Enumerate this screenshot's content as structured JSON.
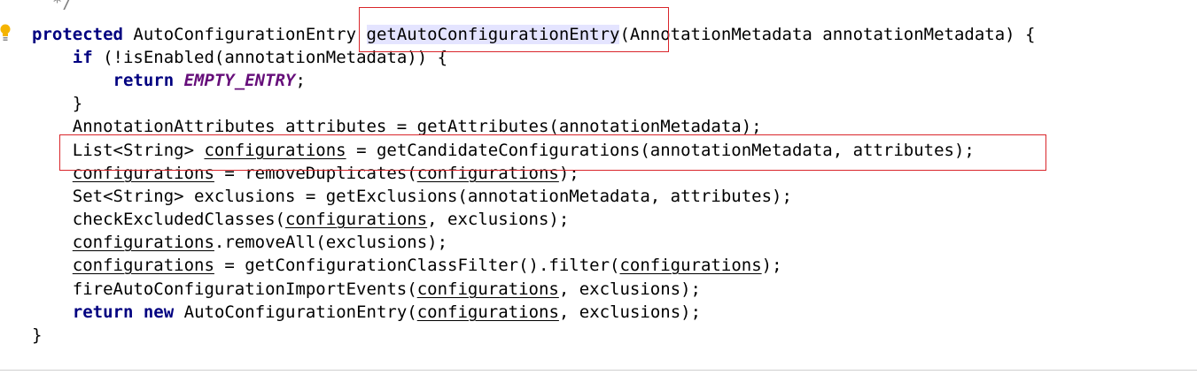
{
  "editor": {
    "lines": [
      {
        "tokens": [
          {
            "t": "  */",
            "c": "comment"
          }
        ]
      },
      {
        "tokens": [
          {
            "t": "protected",
            "c": "kw"
          },
          {
            "t": " AutoConfigurationEntry "
          },
          {
            "t": "",
            "c": "caret"
          },
          {
            "t": "getAutoConfigurationEntry",
            "c": "hl"
          },
          {
            "t": "(AnnotationMetadata annotationMetadata) {"
          }
        ]
      },
      {
        "tokens": [
          {
            "t": "    "
          },
          {
            "t": "if",
            "c": "kw"
          },
          {
            "t": " (!isEnabled(annotationMetadata)) {"
          }
        ]
      },
      {
        "tokens": [
          {
            "t": "        "
          },
          {
            "t": "return",
            "c": "kw"
          },
          {
            "t": " "
          },
          {
            "t": "EMPTY_ENTRY",
            "c": "const"
          },
          {
            "t": ";"
          }
        ]
      },
      {
        "tokens": [
          {
            "t": "    }"
          }
        ]
      },
      {
        "tokens": [
          {
            "t": "    AnnotationAttributes attributes = getAttributes(annotationMetadata);"
          }
        ]
      },
      {
        "tokens": [
          {
            "t": "    List<String> "
          },
          {
            "t": "configurations",
            "c": "var"
          },
          {
            "t": " = getCandidateConfigurations(annotationMetadata, attributes);"
          }
        ]
      },
      {
        "tokens": [
          {
            "t": "    "
          },
          {
            "t": "configurations",
            "c": "var"
          },
          {
            "t": " = removeDuplicates("
          },
          {
            "t": "configurations",
            "c": "var"
          },
          {
            "t": ");"
          }
        ]
      },
      {
        "tokens": [
          {
            "t": "    Set<String> exclusions = getExclusions(annotationMetadata, attributes);"
          }
        ]
      },
      {
        "tokens": [
          {
            "t": "    checkExcludedClasses("
          },
          {
            "t": "configurations",
            "c": "var"
          },
          {
            "t": ", exclusions);"
          }
        ]
      },
      {
        "tokens": [
          {
            "t": "    "
          },
          {
            "t": "configurations",
            "c": "var"
          },
          {
            "t": ".removeAll(exclusions);"
          }
        ]
      },
      {
        "tokens": [
          {
            "t": "    "
          },
          {
            "t": "configurations",
            "c": "var"
          },
          {
            "t": " = getConfigurationClassFilter().filter("
          },
          {
            "t": "configurations",
            "c": "var"
          },
          {
            "t": ");"
          }
        ]
      },
      {
        "tokens": [
          {
            "t": "    fireAutoConfigurationImportEvents("
          },
          {
            "t": "configurations",
            "c": "var"
          },
          {
            "t": ", exclusions);"
          }
        ]
      },
      {
        "tokens": [
          {
            "t": "    "
          },
          {
            "t": "return",
            "c": "kw"
          },
          {
            "t": " "
          },
          {
            "t": "new",
            "c": "kw"
          },
          {
            "t": " AutoConfigurationEntry("
          },
          {
            "t": "configurations",
            "c": "var"
          },
          {
            "t": ", exclusions);"
          }
        ]
      },
      {
        "tokens": [
          {
            "t": "}"
          }
        ]
      }
    ]
  },
  "icons": {
    "gutter": "lightbulb-icon"
  },
  "colors": {
    "keyword": "#000080",
    "constant": "#660e7a",
    "comment": "#808080",
    "highlight_box": "#d9262b",
    "usage_highlight": "#e4e4ff",
    "bulb": "#f5b400"
  }
}
